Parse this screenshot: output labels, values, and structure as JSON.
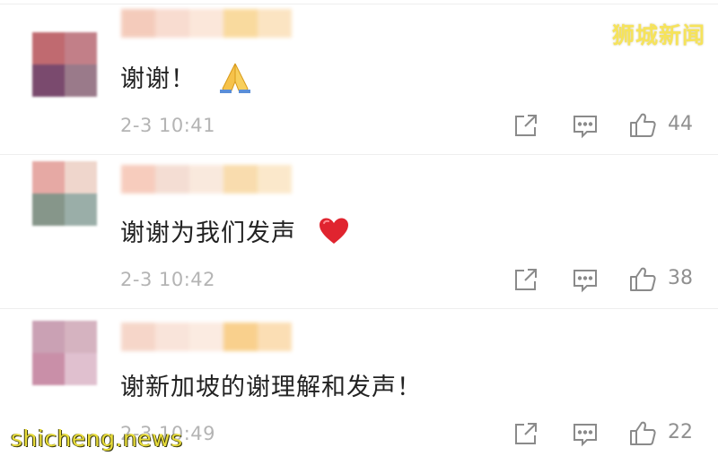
{
  "watermarks": {
    "top_right": "狮城新闻",
    "bottom_left": "shicheng.news"
  },
  "comments": [
    {
      "text": "谢谢！",
      "emoji_icon": "folded-hands-icon",
      "timestamp": "2-3 10:41",
      "like_count": "44",
      "avatar_colors": [
        "#c06a70",
        "#c27f88",
        "#7a4a6e",
        "#9a7a8a"
      ],
      "username_colors": [
        "#f3c3b0",
        "#f7d6c8",
        "#fbe3d4",
        "#f9d48e",
        "#fbe0b8"
      ]
    },
    {
      "text": "谢谢为我们发声",
      "emoji_icon": "red-heart-icon",
      "timestamp": "2-3 10:42",
      "like_count": "38",
      "avatar_colors": [
        "#e6a9a4",
        "#efd6cc",
        "#86968a",
        "#9aaea8"
      ],
      "username_colors": [
        "#f6c4b2",
        "#f3d8cc",
        "#f9e6d8",
        "#f8d7a0",
        "#fbe5c2"
      ]
    },
    {
      "text": "谢新加坡的谢理解和发声！",
      "emoji_icon": "",
      "timestamp": "2-3 10:49",
      "like_count": "22",
      "avatar_colors": [
        "#caa1b4",
        "#d5b3c0",
        "#c98fa8",
        "#e0c0cf"
      ],
      "username_colors": [
        "#f5d0c0",
        "#f9e0d4",
        "#fbe8dc",
        "#f8c87a",
        "#fbd9a8"
      ]
    }
  ],
  "icons": {
    "share": "share-icon",
    "reply": "comment-icon",
    "like": "thumbs-up-icon"
  },
  "colors": {
    "text": "#222222",
    "muted": "#b4b4b4",
    "count": "#909090",
    "watermark": "#f6e35a"
  }
}
